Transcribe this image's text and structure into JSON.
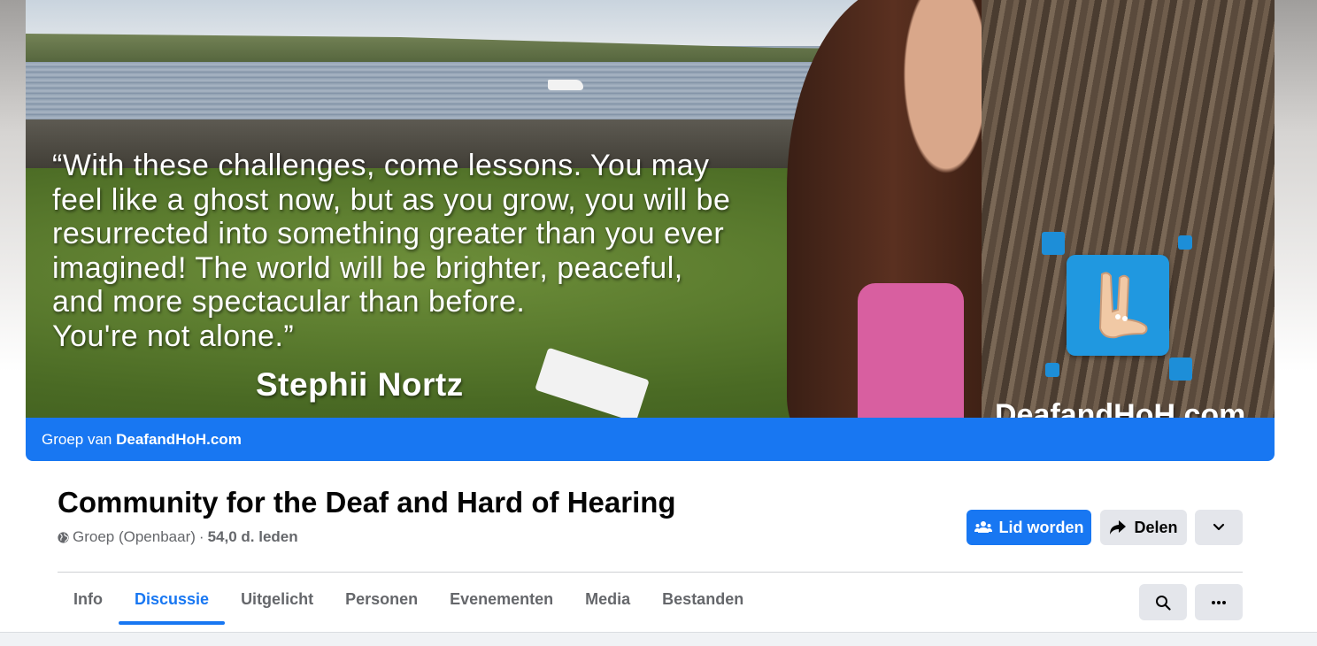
{
  "cover": {
    "quote": "“With these challenges, come lessons. You may\nfeel like a ghost now, but as you grow, you will be\nresurrected into something greater than you ever\nimagined! The world will be brighter, peaceful,\nand more spectacular than before.\nYou're not alone.”",
    "author": "Stephii Nortz",
    "watermark": "DeafandHoH.com"
  },
  "group_bar": {
    "prefix": "Groep van",
    "owner": "DeafandHoH.com"
  },
  "header": {
    "title": "Community for the Deaf and Hard of Hearing",
    "privacy": "Groep (Openbaar)",
    "separator": "·",
    "members": "54,0 d. leden"
  },
  "actions": {
    "join_label": "Lid worden",
    "share_label": "Delen"
  },
  "tabs": [
    {
      "label": "Info"
    },
    {
      "label": "Discussie",
      "active": true
    },
    {
      "label": "Uitgelicht"
    },
    {
      "label": "Personen"
    },
    {
      "label": "Evenementen"
    },
    {
      "label": "Media"
    },
    {
      "label": "Bestanden"
    }
  ],
  "colors": {
    "accent": "#1877f2",
    "button_gray": "#e4e6eb",
    "secondary_text": "#65676b"
  }
}
